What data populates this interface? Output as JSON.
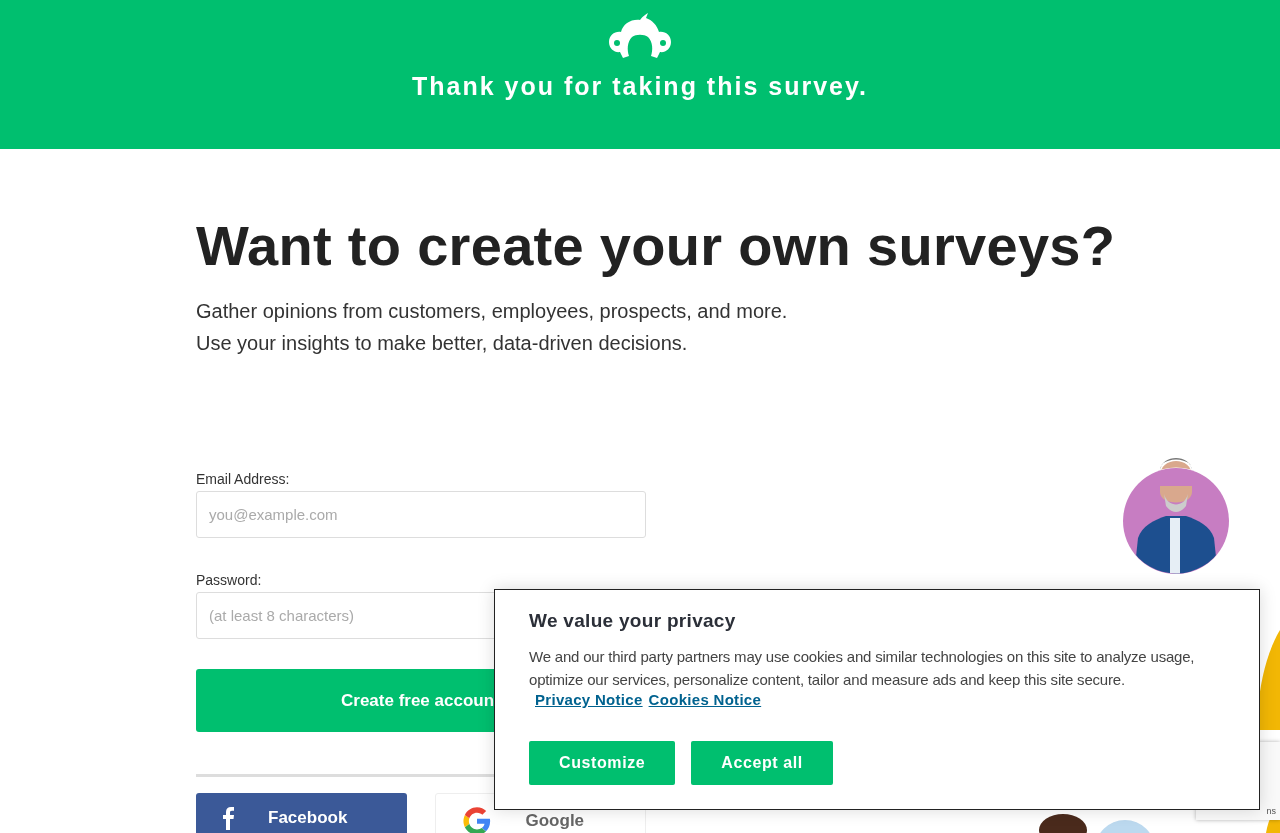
{
  "header": {
    "title": "Thank you for taking this survey."
  },
  "hero": {
    "heading": "Want to create your own surveys?",
    "lines": [
      "Gather opinions from customers, employees, prospects, and more.",
      "Use your insights to make better, data-driven decisions."
    ]
  },
  "form": {
    "fields": [
      {
        "label": "Email Address:",
        "placeholder": "you@example.com"
      },
      {
        "label": "Password:",
        "placeholder": "(at least 8 characters)"
      }
    ],
    "submit": "Create free accoun",
    "social": [
      {
        "kind": "facebook",
        "label": "Facebook"
      },
      {
        "kind": "google",
        "label": "Google"
      }
    ]
  },
  "recaptcha": {
    "text": "ns"
  },
  "consent": {
    "title": "We value your privacy",
    "body": "We and our third party partners may use cookies and similar technologies on this site to analyze usage, optimize our services, personalize content, tailor and measure ads and keep this site secure.",
    "links": [
      "Privacy Notice",
      "Cookies Notice"
    ],
    "buttons": [
      "Customize",
      "Accept all"
    ]
  }
}
